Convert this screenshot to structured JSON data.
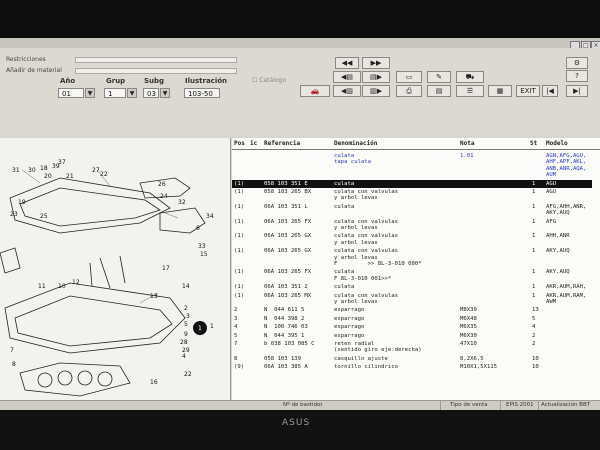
{
  "top": {
    "restricciones": "Restricciones",
    "anadir": "Añadir de material",
    "columns": {
      "ano": "Año",
      "grup": "Grup",
      "subg": "Subg",
      "ilustracion": "Ilustración"
    },
    "values": {
      "ano": "01",
      "grup": "1",
      "subg": "03",
      "ilustracion": "103-50"
    },
    "checkbox_label": "Catálogo",
    "exit_label": "EXIT",
    "help_label": "?"
  },
  "table": {
    "headers": {
      "pos": "Pos",
      "ic": "ic",
      "ref": "Referencia",
      "den": "Denominación",
      "nota": "Nota",
      "st": "St",
      "modelo": "Modelo"
    },
    "rows": [
      {
        "pos": "",
        "ref": "",
        "den": "culata",
        "den2": "tapa culata",
        "nota": "1.01",
        "st": "",
        "model": "AGN,AFG,AGU,",
        "model2": "AHF,APF,AKL,",
        "model3": "ANB,ANR,AQA,",
        "model4": "AUM",
        "blue": true
      },
      {
        "pos": "(1)",
        "ref": "058 103 351 E",
        "den": "culata",
        "den2": "",
        "nota": "",
        "st": "1",
        "model": "AGU",
        "sel": true
      },
      {
        "pos": "(1)",
        "ref": "058 103 265 BX",
        "den": "culata con valvulas",
        "den2": "y arbol levas",
        "nota": "",
        "st": "1",
        "model": "AGU"
      },
      {
        "pos": "(1)",
        "ref": "06A 103 351 L",
        "den": "culata",
        "den2": "",
        "nota": "",
        "st": "1",
        "model": "AFG,AHH,ANR,",
        "model2": "AKY,AUQ"
      },
      {
        "pos": "(1)",
        "ref": "06A 103 265 FX",
        "den": "culata con valvulas",
        "den2": "y arbol levas",
        "nota": "",
        "st": "1",
        "model": "AFG"
      },
      {
        "pos": "(1)",
        "ref": "06A 103 265 GX",
        "den": "culata con valvulas",
        "den2": "y arbol levas",
        "nota": "",
        "st": "1",
        "model": "AHH,ANR"
      },
      {
        "pos": "(1)",
        "ref": "06A 103 265 GX",
        "den": "culata con valvulas",
        "den2": "y arbol levas",
        "den3": "F         >> 8L-3-010 000*",
        "nota": "",
        "st": "1",
        "model": "AKY,AUQ"
      },
      {
        "pos": "(1)",
        "ref": "06A 103 265 FX",
        "den": "culata",
        "den2": "F 8L-3-010 001>>*",
        "nota": "",
        "st": "1",
        "model": "AKY,AUQ"
      },
      {
        "pos": "(1)",
        "ref": "06A 103 351 2",
        "den": "culata",
        "den2": "",
        "nota": "",
        "st": "1",
        "model": "AKR,AUM,RAH,"
      },
      {
        "pos": "(1)",
        "ref": "06A 103 265 MX",
        "den": "culata con valvulas",
        "den2": "y arbol levas",
        "nota": "",
        "st": "1",
        "model": "AKR,AUM,RAM,",
        "model2": "AWM"
      },
      {
        "pos": "2",
        "ref": "N  044 611 5",
        "den": "esparrago",
        "den2": "",
        "nota": "M8X30",
        "st": "13",
        "model": ""
      },
      {
        "pos": "3",
        "ref": "N  044 398 2",
        "den": "esparrago",
        "den2": "",
        "nota": "M6X48",
        "st": "5",
        "model": ""
      },
      {
        "pos": "4",
        "ref": "N  100 746 03",
        "den": "esparrago",
        "den2": "",
        "nota": "M6X35",
        "st": "4",
        "model": ""
      },
      {
        "pos": "5",
        "ref": "N  044 395 1",
        "den": "esparrago",
        "den2": "",
        "nota": "M6X30",
        "st": "2",
        "model": ""
      },
      {
        "pos": "7",
        "ref": "b 038 103 085 C",
        "den": "reten radial",
        "den2": "(sentido giro eje:derecha)",
        "nota": "47X10",
        "st": "2",
        "model": ""
      },
      {
        "pos": "8",
        "ref": "058 103 139",
        "den": "casquillo ajuste",
        "den2": "",
        "nota": "8,2X6,5",
        "st": "10",
        "model": ""
      },
      {
        "pos": "(9)",
        "ref": "06A 103 385 A",
        "den": "tornillo cilindrico",
        "den2": "",
        "nota": "M10X1,5X115",
        "st": "10",
        "model": ""
      }
    ]
  },
  "diagram": {
    "labels": [
      "31",
      "30",
      "18",
      "39",
      "27",
      "20",
      "21",
      "22",
      "19",
      "23",
      "25",
      "26",
      "24",
      "32",
      "6",
      "15",
      "17",
      "12",
      "10",
      "11",
      "13",
      "14",
      "28",
      "9",
      "3",
      "2",
      "5",
      "29",
      "4",
      "16",
      "22",
      "7",
      "8",
      "1",
      "33",
      "34",
      "37"
    ]
  },
  "status": {
    "bastidor": "Nº de bastidor",
    "tipo": "Tipo de venta",
    "version": "EPIS 2001",
    "actualizacion": "Actualización BBT"
  },
  "brand": "ASUS"
}
